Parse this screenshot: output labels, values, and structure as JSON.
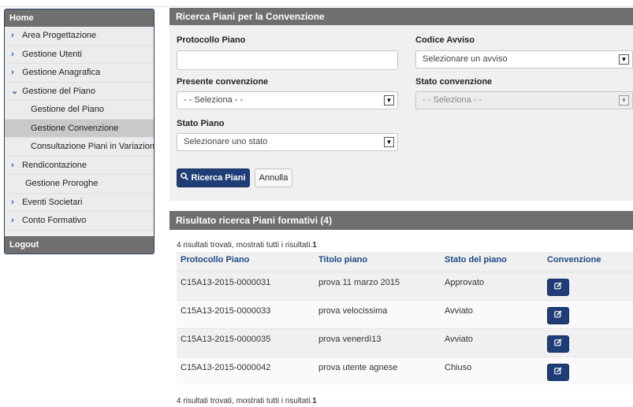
{
  "sidebar": {
    "home": "Home",
    "items": [
      {
        "label": "Area Progettazione",
        "chevron": "›"
      },
      {
        "label": "Gestione Utenti",
        "chevron": "›"
      },
      {
        "label": "Gestione Anagrafica",
        "chevron": "›"
      },
      {
        "label": "Gestione del Piano",
        "chevron": "⌄"
      },
      {
        "label": "Gestione del Piano"
      },
      {
        "label": "Gestione Convenzione"
      },
      {
        "label": "Consultazione Piani in Variazione"
      },
      {
        "label": "Rendicontazione",
        "chevron": "›"
      },
      {
        "label": "Gestione Proroghe"
      },
      {
        "label": "Eventi Societari",
        "chevron": "›"
      },
      {
        "label": "Conto Formativo",
        "chevron": "›"
      }
    ],
    "logout": "Logout"
  },
  "search": {
    "title": "Ricerca Piani per la Convenzione",
    "protocollo_label": "Protocollo Piano",
    "protocollo_value": "",
    "codice_label": "Codice Avviso",
    "codice_value": "Selezionare un avviso",
    "presente_label": "Presente convenzione",
    "presente_value": "- - Seleziona - -",
    "stato_conv_label": "Stato convenzione",
    "stato_conv_value": "- - Seleziona - -",
    "stato_piano_label": "Stato Piano",
    "stato_piano_value": "Selezionare uno stato",
    "search_button": "Ricerca Piani",
    "cancel_button": "Annulla"
  },
  "results": {
    "title": "Risultato ricerca Piani formativi (4)",
    "info_text": "4 risultati trovati, mostrati tutti i risultati.",
    "info_page": "1",
    "columns": [
      "Protocollo Piano",
      "Titolo piano",
      "Stato del piano",
      "Convenzione"
    ],
    "rows": [
      {
        "protocollo": "C15A13-2015-0000031",
        "titolo": "prova 11 marzo 2015",
        "stato": "Approvato"
      },
      {
        "protocollo": "C15A13-2015-0000033",
        "titolo": "prova velocissima",
        "stato": "Avviato"
      },
      {
        "protocollo": "C15A13-2015-0000035",
        "titolo": "prova venerdì13",
        "stato": "Avviato"
      },
      {
        "protocollo": "C15A13-2015-0000042",
        "titolo": "prova utente agnese",
        "stato": "Chiuso"
      }
    ]
  },
  "icons": {
    "search": "search-icon",
    "edit": "edit-icon",
    "chevron_right": "chevron-right-icon",
    "chevron_down": "chevron-down-icon"
  }
}
